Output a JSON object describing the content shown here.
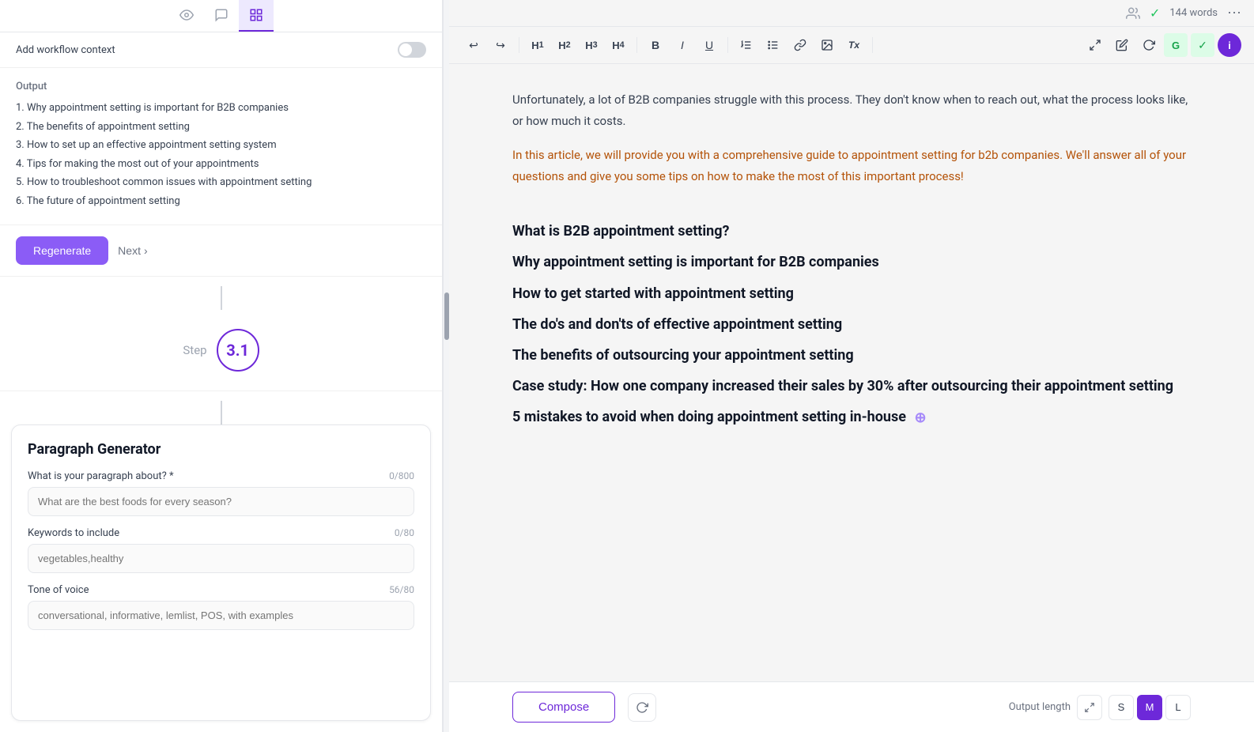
{
  "header": {
    "word_count": "144 words",
    "check_icon": "✓",
    "more_icon": "⋯"
  },
  "panel_tabs": [
    {
      "id": "eye",
      "icon": "👁",
      "active": false
    },
    {
      "id": "chat",
      "icon": "💬",
      "active": false
    },
    {
      "id": "layout",
      "icon": "⊞",
      "active": true
    }
  ],
  "context_toggle": {
    "label": "Add workflow context"
  },
  "output": {
    "label": "Output",
    "items": [
      "1. Why appointment setting is important for B2B companies",
      "2. The benefits of appointment setting",
      "3. How to set up an effective appointment setting system",
      "4. Tips for making the most out of your appointments",
      "5. How to troubleshoot common issues with appointment setting",
      "6. The future of appointment setting"
    ]
  },
  "buttons": {
    "regenerate": "Regenerate",
    "next": "Next"
  },
  "step": {
    "label": "Step",
    "number": "3.1"
  },
  "paragraph_generator": {
    "title": "Paragraph Generator",
    "about_label": "What is your paragraph about? *",
    "about_counter": "0/800",
    "about_placeholder": "What are the best foods for every season?",
    "keywords_label": "Keywords to include",
    "keywords_counter": "0/80",
    "keywords_placeholder": "vegetables,healthy",
    "tone_label": "Tone of voice",
    "tone_counter": "56/80",
    "tone_placeholder": "conversational, informative, lemlist, POS, with examples"
  },
  "editor": {
    "toolbar": {
      "undo": "↩",
      "redo": "↪",
      "h1": "H₁",
      "h2": "H₂",
      "h3": "H₃",
      "h4": "H₄",
      "bold": "B",
      "italic": "I",
      "underline": "U",
      "ordered_list": "≡",
      "unordered_list": "☰",
      "link": "🔗",
      "image": "🖼",
      "clear": "Tx"
    },
    "right_icons": [
      {
        "id": "arrows",
        "icon": "⇄"
      },
      {
        "id": "edit",
        "icon": "✏"
      },
      {
        "id": "refresh2",
        "icon": "↻"
      },
      {
        "id": "grammarly",
        "icon": "G",
        "style": "green"
      },
      {
        "id": "shield",
        "icon": "✓",
        "style": "green"
      },
      {
        "id": "info",
        "icon": "i",
        "style": "purple"
      }
    ],
    "content": {
      "intro_text1": "Unfortunately, a lot of B2B companies struggle with this process. They don't know when to reach out, what the process looks like, or how much it costs.",
      "intro_text2": "In this article, we will provide you with a comprehensive guide to appointment setting for b2b companies. We'll answer all of your questions and give you some tips on how to make the most of this important process!",
      "headings": [
        "What is B2B appointment setting?",
        "Why appointment setting is important for B2B companies",
        "How to get started with appointment setting",
        "The do's and don'ts of effective appointment setting",
        "The benefits of outsourcing your appointment setting",
        "Case study: How one company increased their sales by 30% after outsourcing their appointment setting",
        "5 mistakes to avoid when doing appointment setting in-house"
      ]
    }
  },
  "bottom_bar": {
    "compose_label": "Compose",
    "output_length_label": "Output length",
    "length_options": [
      "S",
      "M",
      "L"
    ],
    "active_length": "M"
  }
}
